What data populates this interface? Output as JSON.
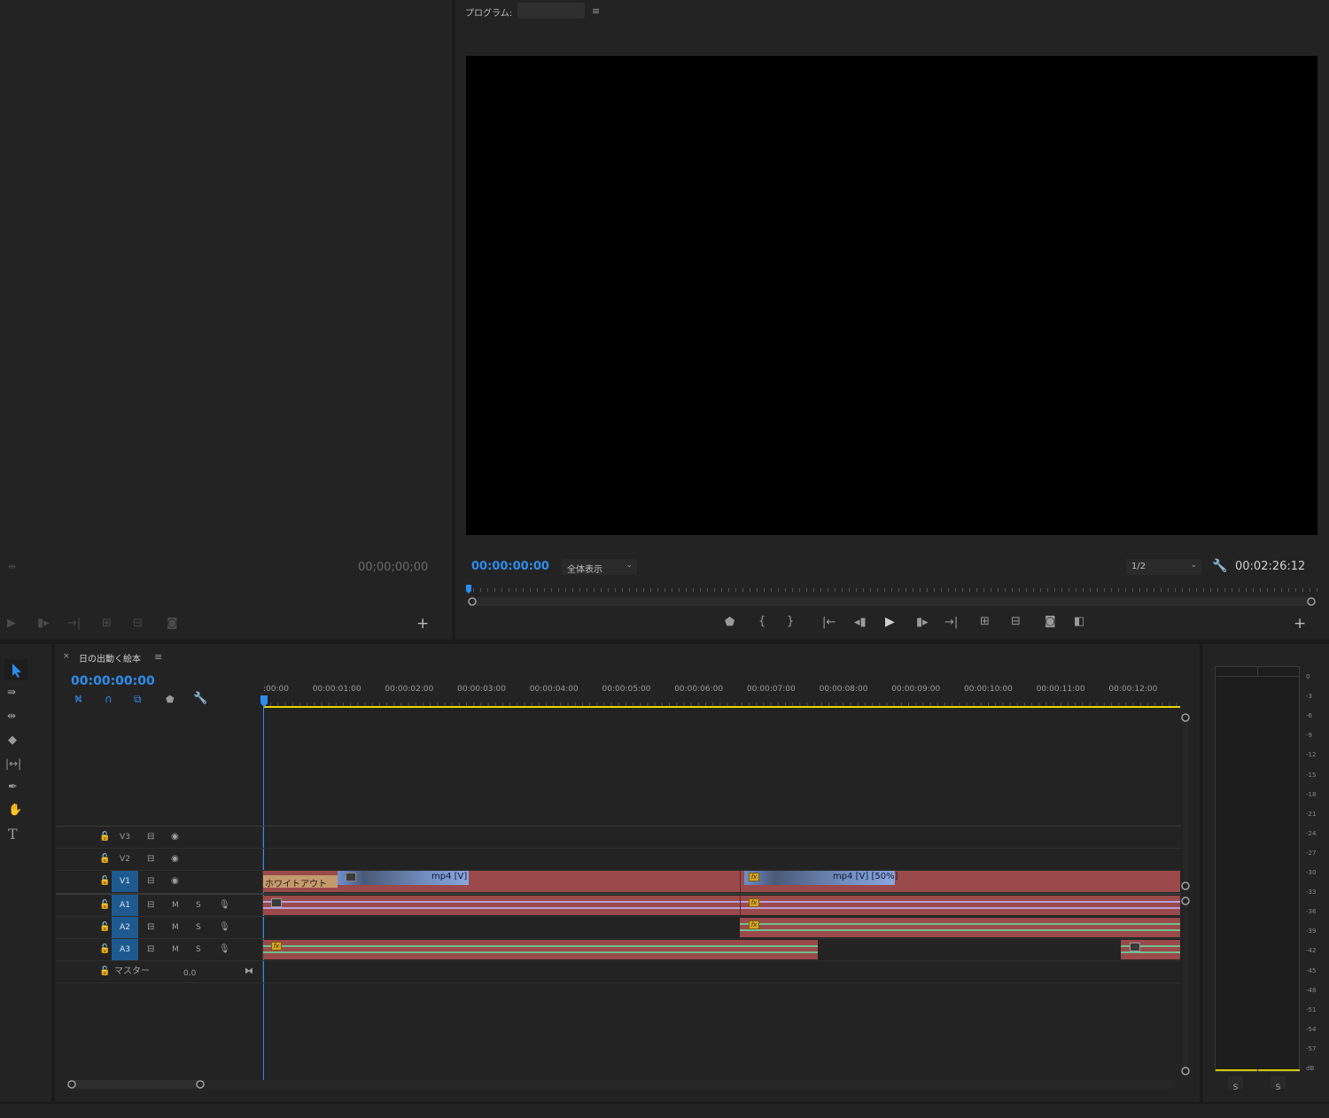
{
  "source_monitor": {
    "timecode": "00;00;00;00"
  },
  "program_monitor": {
    "title": "プログラム:",
    "timecode": "00:00:00:00",
    "zoom": "全体表示",
    "resolution": "1/2",
    "duration": "00:02:26:12"
  },
  "timeline": {
    "sequence_name": "日の出動く絵本",
    "timecode": "00:00:00:00",
    "ruler": [
      ":00:00",
      "00:00:01:00",
      "00:00:02:00",
      "00:00:03:00",
      "00:00:04:00",
      "00:00:05:00",
      "00:00:06:00",
      "00:00:07:00",
      "00:00:08:00",
      "00:00:09:00",
      "00:00:10:00",
      "00:00:11:00",
      "00:00:12:00"
    ],
    "tracks": {
      "v3": "V3",
      "v2": "V2",
      "v1": "V1",
      "a1": "A1",
      "a2": "A2",
      "a3": "A3",
      "master": "マスター",
      "master_value": "0.0",
      "mute": "M",
      "solo": "S"
    },
    "clips": {
      "transition": "ホワイトアウト",
      "clip1": "mp4 [V]",
      "clip2": "mp4 [V] [50%]",
      "fx": "fx"
    }
  },
  "meter": {
    "scale": [
      "0",
      "-3",
      "-6",
      "-9",
      "-12",
      "-15",
      "-18",
      "-21",
      "-24",
      "-27",
      "-30",
      "-33",
      "-36",
      "-39",
      "-42",
      "-45",
      "-48",
      "-51",
      "-54",
      "-57",
      "dB"
    ],
    "solo_left": "S",
    "solo_right": "S"
  },
  "colors": {
    "accent": "#2d8ceb",
    "clip_red": "#9a4a4a",
    "clip_blue": "#6f8fcf",
    "transition": "#c49a6c",
    "work_area": "#e4d900",
    "fx": "#d3a423"
  }
}
